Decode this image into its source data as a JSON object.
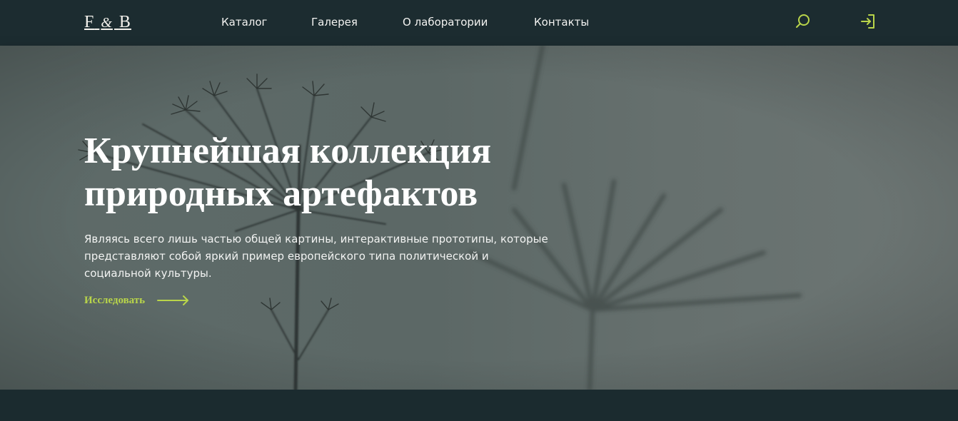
{
  "header": {
    "logo": {
      "left": "F",
      "amp": "&",
      "right": "B"
    },
    "nav": [
      {
        "label": "Каталог"
      },
      {
        "label": "Галерея"
      },
      {
        "label": "О лаборатории"
      },
      {
        "label": "Контакты"
      }
    ],
    "icons": {
      "search": "search-icon",
      "login": "login-icon"
    }
  },
  "hero": {
    "title": "Крупнейшая коллекция природных артефактов",
    "description": "Являясь всего лишь частью общей картины, интерактивные прототипы, которые представляют собой яркий пример европейского типа политической и социальной культуры.",
    "cta_label": "Исследовать"
  },
  "colors": {
    "header_bg": "#1c2c30",
    "accent": "#b9d54a",
    "hero_overlay": "#5e6b69",
    "text_light": "#ffffff"
  }
}
